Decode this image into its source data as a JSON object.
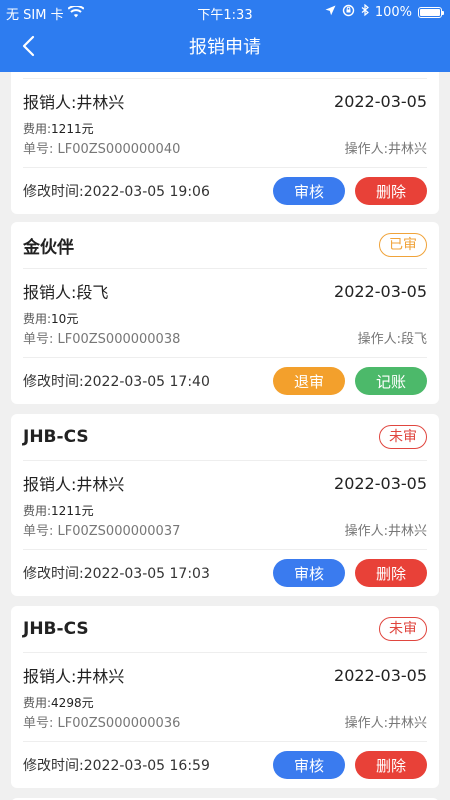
{
  "status": {
    "carrier": "无 SIM 卡",
    "time": "下午1:33",
    "battery": "100%",
    "battery_level": 1.0
  },
  "header": {
    "title": "报销申请",
    "back_icon": "chevron-left-icon"
  },
  "colors": {
    "primary": "#2d7cf0",
    "approve": "#3a7bef",
    "delete": "#e84138",
    "reject": "#f3a02c",
    "record": "#4cb96a",
    "approved_badge": "#f0a33a",
    "unapproved_badge": "#e0463f"
  },
  "cards": [
    {
      "name": "",
      "badge": "",
      "applicant": "报销人:井林兴",
      "date": "2022-03-05",
      "fee_label": "费用:",
      "fee_value": "1211元",
      "order_no": "单号:  LF00ZS000000040",
      "operator": "操作人:井林兴",
      "modified": "修改时间:2022-03-05 19:06",
      "buttons": [
        "审核",
        "删除"
      ]
    },
    {
      "name": "金伙伴",
      "badge": "已审",
      "applicant": "报销人:段飞",
      "date": "2022-03-05",
      "fee_label": "费用:",
      "fee_value": "10元",
      "order_no": "单号:  LF00ZS000000038",
      "operator": "操作人:段飞",
      "modified": "修改时间:2022-03-05 17:40",
      "buttons": [
        "退审",
        "记账"
      ]
    },
    {
      "name": "JHB-CS",
      "badge": "未审",
      "applicant": "报销人:井林兴",
      "date": "2022-03-05",
      "fee_label": "费用:",
      "fee_value": "1211元",
      "order_no": "单号:  LF00ZS000000037",
      "operator": "操作人:井林兴",
      "modified": "修改时间:2022-03-05 17:03",
      "buttons": [
        "审核",
        "删除"
      ]
    },
    {
      "name": "JHB-CS",
      "badge": "未审",
      "applicant": "报销人:井林兴",
      "date": "2022-03-05",
      "fee_label": "费用:",
      "fee_value": "4298元",
      "order_no": "单号:  LF00ZS000000036",
      "operator": "操作人:井林兴",
      "modified": "修改时间:2022-03-05 16:59",
      "buttons": [
        "审核",
        "删除"
      ]
    }
  ]
}
